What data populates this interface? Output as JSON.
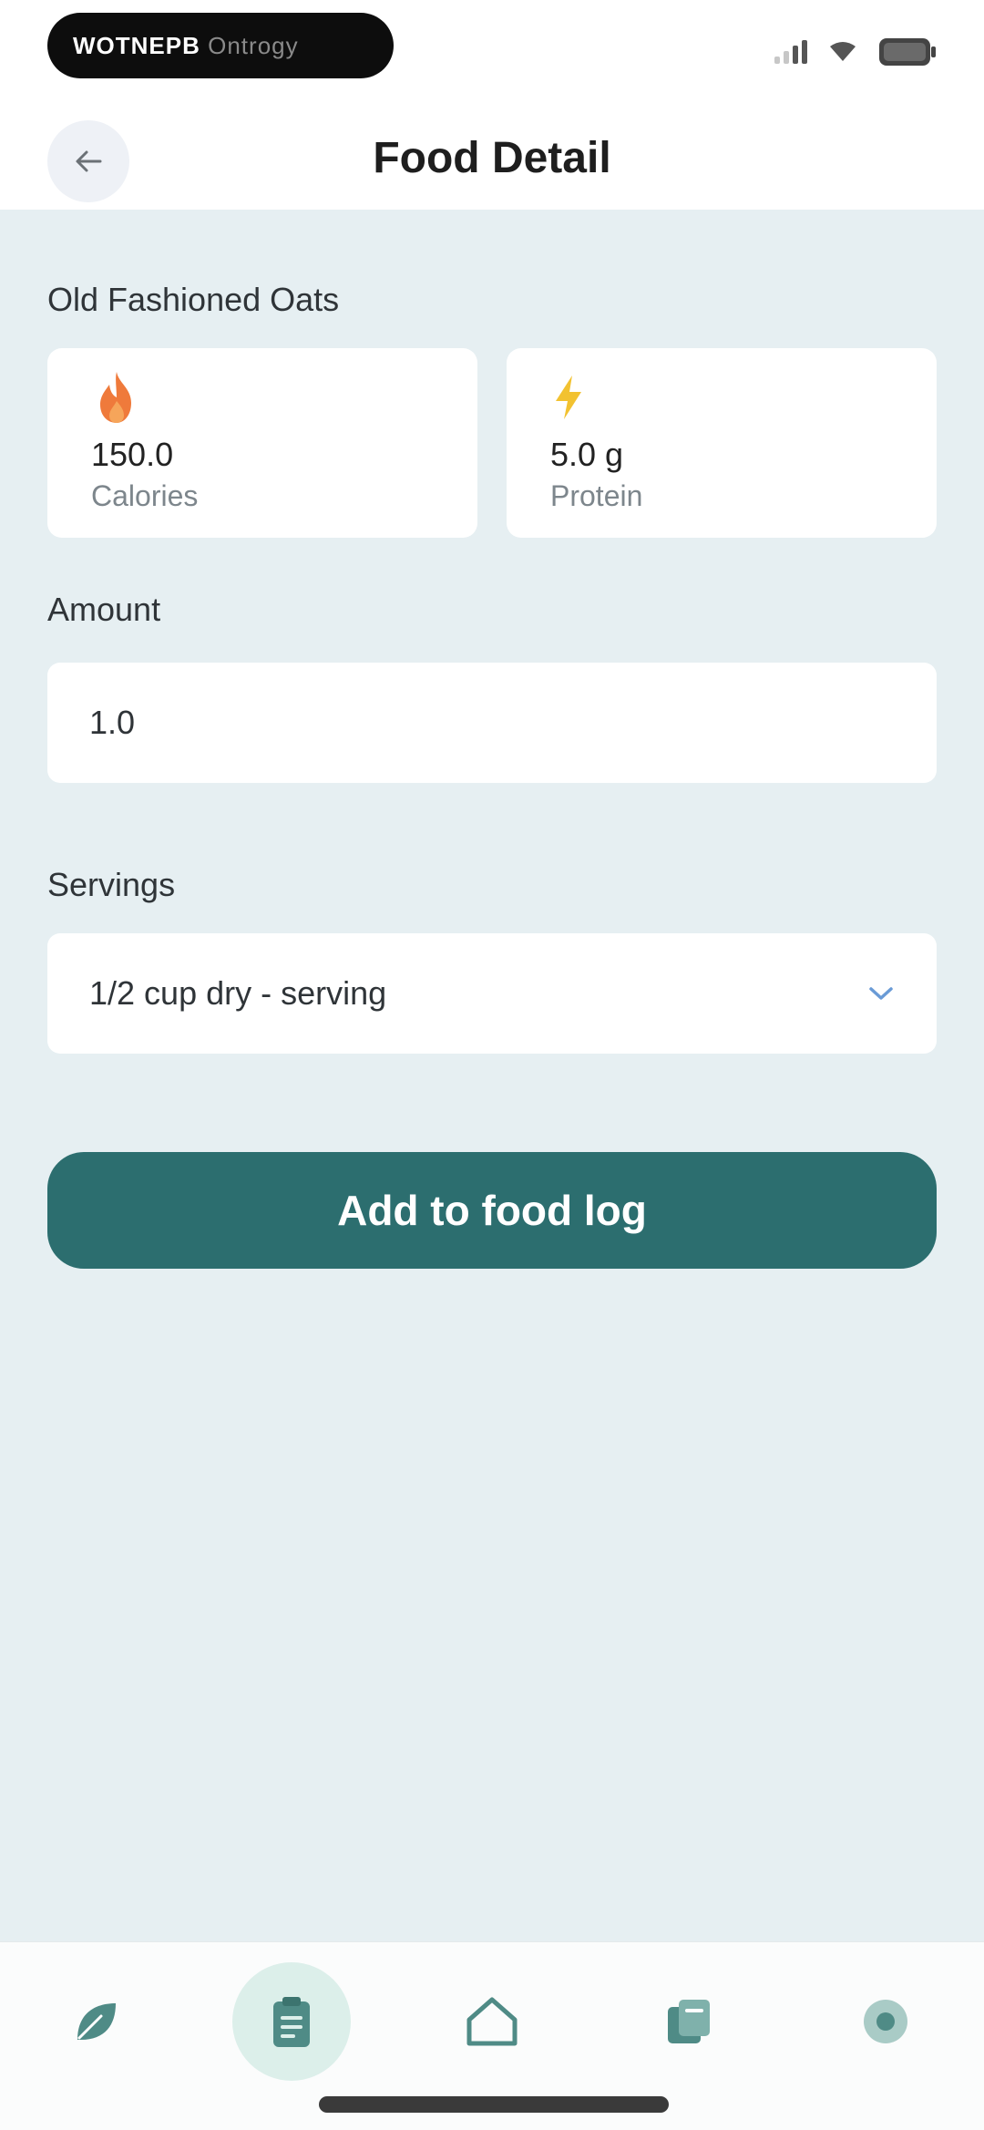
{
  "status_bar": {
    "pill_text_bold": "WOTNEPB",
    "pill_text_dim": "Ontrogy"
  },
  "header": {
    "title": "Food Detail"
  },
  "food": {
    "name": "Old Fashioned Oats",
    "stats": [
      {
        "icon": "flame-icon",
        "value": "150.0",
        "label": "Calories",
        "color": "#ef7a3b"
      },
      {
        "icon": "lightning-icon",
        "value": "5.0 g",
        "label": "Protein",
        "color": "#f2c231"
      }
    ]
  },
  "form": {
    "amount_label": "Amount",
    "amount_value": "1.0",
    "servings_label": "Servings",
    "servings_value": "1/2 cup dry - serving"
  },
  "actions": {
    "add_label": "Add to food log"
  },
  "nav": {
    "items": [
      {
        "icon": "leaf-icon",
        "active": false
      },
      {
        "icon": "clipboard-icon",
        "active": true
      },
      {
        "icon": "home-icon",
        "active": false
      },
      {
        "icon": "book-icon",
        "active": false
      },
      {
        "icon": "settings-icon",
        "active": false
      }
    ]
  },
  "colors": {
    "accent": "#2c6e6f",
    "content_bg": "#e6eff2",
    "nav_icon": "#4f8b86",
    "nav_active_bg": "#dcefea"
  }
}
